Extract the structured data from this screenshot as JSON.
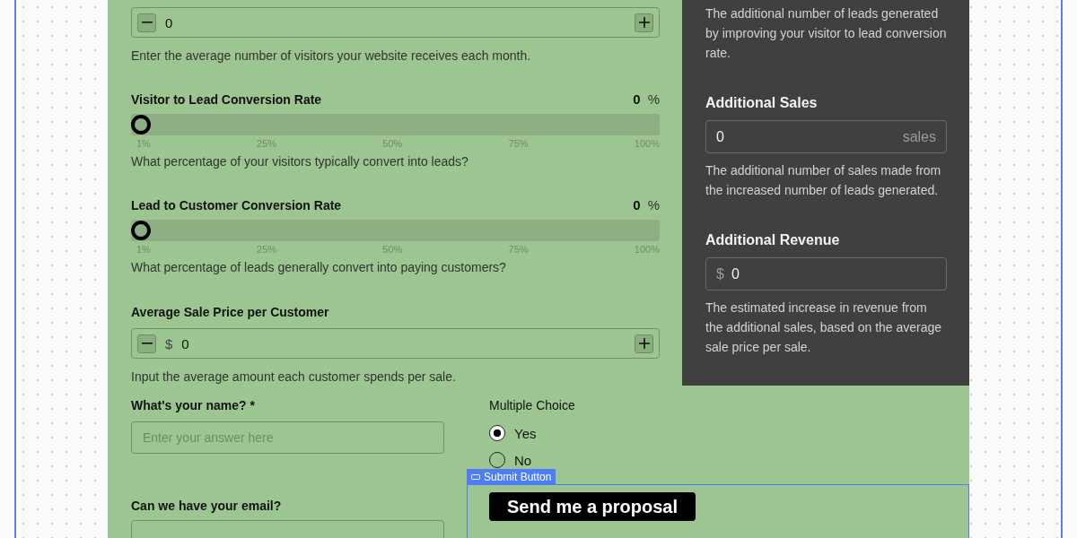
{
  "visitors_field": {
    "value": "0",
    "help": "Enter the average number of visitors your website receives each month."
  },
  "sliders": [
    {
      "label": "Visitor to Lead Conversion Rate",
      "value": "0",
      "unit": "%",
      "level": 0,
      "ticks": [
        "1%",
        "25%",
        "50%",
        "75%",
        "100%"
      ],
      "help": "What percentage of your visitors typically convert into leads?"
    },
    {
      "label": "Lead to Customer Conversion Rate",
      "value": "0",
      "unit": "%",
      "level": 0,
      "ticks": [
        "1%",
        "25%",
        "50%",
        "75%",
        "100%"
      ],
      "help": "What percentage of leads generally convert into paying customers?"
    }
  ],
  "price_field": {
    "label": "Average Sale Price per Customer",
    "currency": "$",
    "value": "0",
    "help": "Input the average amount each customer spends per sale."
  },
  "results": [
    {
      "help": "The additional number of leads generated by improving your visitor to lead conversion rate."
    },
    {
      "label": "Additional Sales",
      "value": "0",
      "suffix": "sales",
      "help": "The additional number of sales made from the increased number of leads generated."
    },
    {
      "label": "Additional Revenue",
      "prefix": "$",
      "value": "0",
      "help": "The estimated increase in revenue from the additional sales, based on the average sale price per sale."
    }
  ],
  "name_question": {
    "label": "What's your name? *",
    "placeholder": "Enter your answer here"
  },
  "choice": {
    "label": "Multiple Choice",
    "options": [
      {
        "label": "Yes",
        "selected": true
      },
      {
        "label": "No",
        "selected": false
      }
    ]
  },
  "submit_block": {
    "tag": "Submit Button",
    "button": "Send me a proposal"
  },
  "email_question": {
    "label": "Can we have your email?"
  }
}
